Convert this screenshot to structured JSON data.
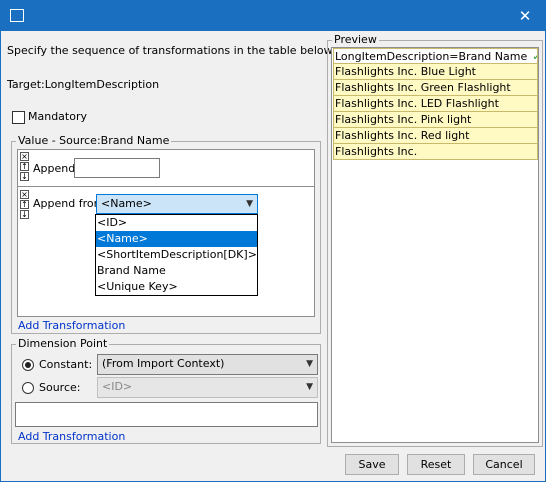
{
  "window": {
    "close_icon": "close-icon",
    "app_icon": "window-icon"
  },
  "instructions": "Specify the sequence of transformations in the table below.",
  "target": "Target:LongItemDescription",
  "mandatory": {
    "label": "Mandatory",
    "checked": false
  },
  "value_group": {
    "legend": "Value - Source:Brand Name",
    "rows": [
      {
        "label": "Append",
        "value": ""
      },
      {
        "label": "Append from",
        "selected": "<Name>"
      }
    ],
    "dropdown_options": [
      "<ID>",
      "<Name>",
      "<ShortItemDescription[DK]>",
      "Brand Name",
      "<Unique Key>"
    ],
    "dropdown_selected_index": 1,
    "add_link": "Add Transformation"
  },
  "dimension_group": {
    "legend": "Dimension Point",
    "constant_label": "Constant:",
    "constant_value": "(From Import Context)",
    "source_label": "Source:",
    "source_value": "<ID>",
    "selected_radio": "constant",
    "add_link": "Add Transformation"
  },
  "preview": {
    "legend": "Preview",
    "header": "LongItemDescription=Brand Name",
    "rows": [
      "Flashlights Inc. Blue Light",
      "Flashlights Inc. Green Flashlight",
      "Flashlights Inc. LED Flashlight",
      "Flashlights Inc. Pink light",
      "Flashlights Inc. Red light",
      "Flashlights Inc."
    ]
  },
  "buttons": {
    "save": "Save",
    "reset": "Reset",
    "cancel": "Cancel"
  },
  "colors": {
    "titlebar": "#1a6fc1",
    "selection": "#0078d7",
    "preview_row": "#fff9c4",
    "link": "#0033cc",
    "check": "#2a9d2a"
  }
}
